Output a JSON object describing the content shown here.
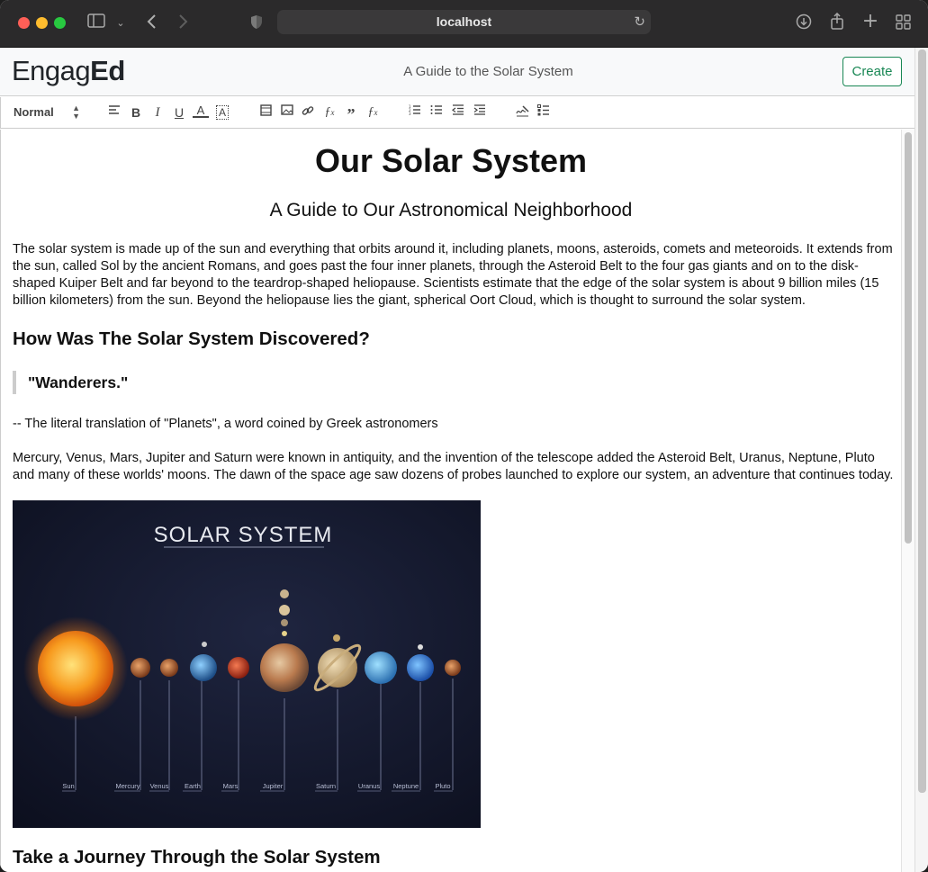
{
  "browser": {
    "url": "localhost",
    "colors": {
      "close": "#ff5f57",
      "minimize": "#febc2e",
      "maximize": "#28c840"
    }
  },
  "app": {
    "logo_regular": "Engag",
    "logo_bold": "Ed",
    "document_title": "A Guide to the Solar System",
    "create_label": "Create",
    "accent": "#198754"
  },
  "toolbar": {
    "format_select": "Normal",
    "icons": [
      "align-icon",
      "bold-icon",
      "italic-icon",
      "underline-icon",
      "text-color-icon",
      "highlight-icon",
      "video-icon",
      "image-icon",
      "link-icon",
      "formula-icon",
      "blockquote-icon",
      "clear-format-icon",
      "ordered-list-icon",
      "bullet-list-icon",
      "outdent-icon",
      "indent-icon",
      "signature-icon",
      "checklist-icon"
    ]
  },
  "document": {
    "title": "Our Solar System",
    "subtitle": "A Guide to Our Astronomical Neighborhood",
    "intro": "The solar system is made up of the sun and everything that orbits around it, including planets, moons, asteroids, comets and meteoroids. It extends from the sun, called Sol by the ancient Romans, and goes past the four inner planets, through the Asteroid Belt to the four gas giants and on to the disk-shaped Kuiper Belt and far beyond to the teardrop-shaped heliopause. Scientists estimate that the edge of the solar system is about 9 billion miles (15 billion kilometers) from the sun. Beyond the heliopause lies the giant, spherical Oort Cloud, which is thought to surround the solar system.",
    "heading_discovery": "How Was The Solar System Discovered?",
    "quote": "\"Wanderers.\"",
    "attribution": "-- The literal translation of \"Planets\", a word coined by Greek astronomers",
    "paragraph2": "Mercury, Venus, Mars, Jupiter and Saturn were known in antiquity, and the invention of the telescope added the Asteroid Belt, Uranus, Neptune, Pluto and many of these worlds' moons. The dawn of the space age saw dozens of probes launched to explore our system, an adventure that continues today.",
    "image": {
      "title": "SOLAR SYSTEM",
      "labels": [
        "Sun",
        "Mercury",
        "Venus",
        "Earth",
        "Mars",
        "Jupiter",
        "Saturn",
        "Uranus",
        "Neptune",
        "Pluto"
      ]
    },
    "heading_journey": "Take a Journey Through the Solar System"
  }
}
